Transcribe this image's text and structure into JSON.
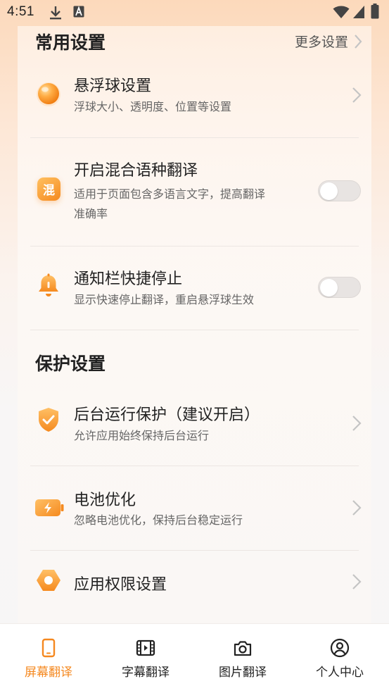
{
  "status_bar": {
    "time": "4:51",
    "icons": [
      "download-icon",
      "text-a-icon",
      "wifi-icon",
      "signal-icon",
      "battery-icon"
    ]
  },
  "common_settings": {
    "title": "常用设置",
    "more_label": "更多设置",
    "items": [
      {
        "icon": "float-ball-icon",
        "title": "悬浮球设置",
        "subtitle": "浮球大小、透明度、位置等设置",
        "control": "chevron"
      },
      {
        "icon": "mixed-language-icon",
        "icon_text": "混",
        "title": "开启混合语种翻译",
        "subtitle_lines": [
          "适用于页面包含多语言文字，提高翻译",
          "准确率"
        ],
        "control": "toggle",
        "enabled": false
      },
      {
        "icon": "bell-icon",
        "title": "通知栏快捷停止",
        "subtitle": "显示快速停止翻译，重启悬浮球生效",
        "control": "toggle",
        "enabled": false
      }
    ]
  },
  "protection_settings": {
    "title": "保护设置",
    "items": [
      {
        "icon": "shield-check-icon",
        "title": "后台运行保护（建议开启）",
        "subtitle": "允许应用始终保持后台运行",
        "control": "chevron"
      },
      {
        "icon": "battery-charging-icon",
        "title": "电池优化",
        "subtitle": "忽略电池优化，保持后台稳定运行",
        "control": "chevron"
      },
      {
        "icon": "hexagon-icon",
        "title": "应用权限设置",
        "control": "chevron"
      }
    ]
  },
  "tabs": [
    {
      "label": "屏幕翻译",
      "icon": "phone-icon",
      "active": true
    },
    {
      "label": "字幕翻译",
      "icon": "film-icon",
      "active": false
    },
    {
      "label": "图片翻译",
      "icon": "camera-icon",
      "active": false
    },
    {
      "label": "个人中心",
      "icon": "user-circle-icon",
      "active": false
    }
  ],
  "colors": {
    "accent": "#f5881f",
    "accent_light": "#ffb347"
  }
}
